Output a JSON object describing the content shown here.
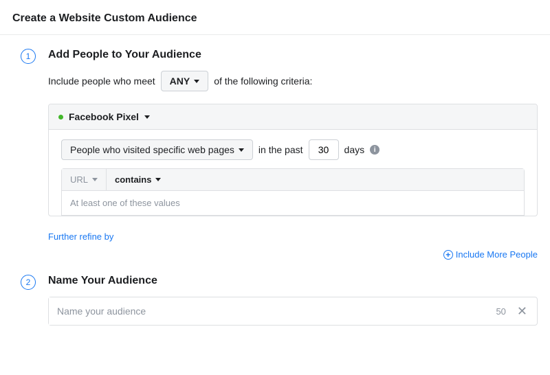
{
  "header": {
    "title": "Create a Website Custom Audience"
  },
  "step1": {
    "title": "Add People to Your Audience",
    "include_prefix": "Include people who meet",
    "any_label": "ANY",
    "include_suffix": "of the following criteria:",
    "pixel_label": "Facebook Pixel",
    "visitor_label": "People who visited specific web pages",
    "past_prefix": "in the past",
    "days_value": "30",
    "past_suffix": "days",
    "url_label": "URL",
    "contains_label": "contains",
    "value_placeholder": "At least one of these values",
    "refine_label": "Further refine by",
    "include_more_label": "Include More People"
  },
  "step2": {
    "title": "Name Your Audience",
    "name_placeholder": "Name your audience",
    "counter": "50"
  }
}
